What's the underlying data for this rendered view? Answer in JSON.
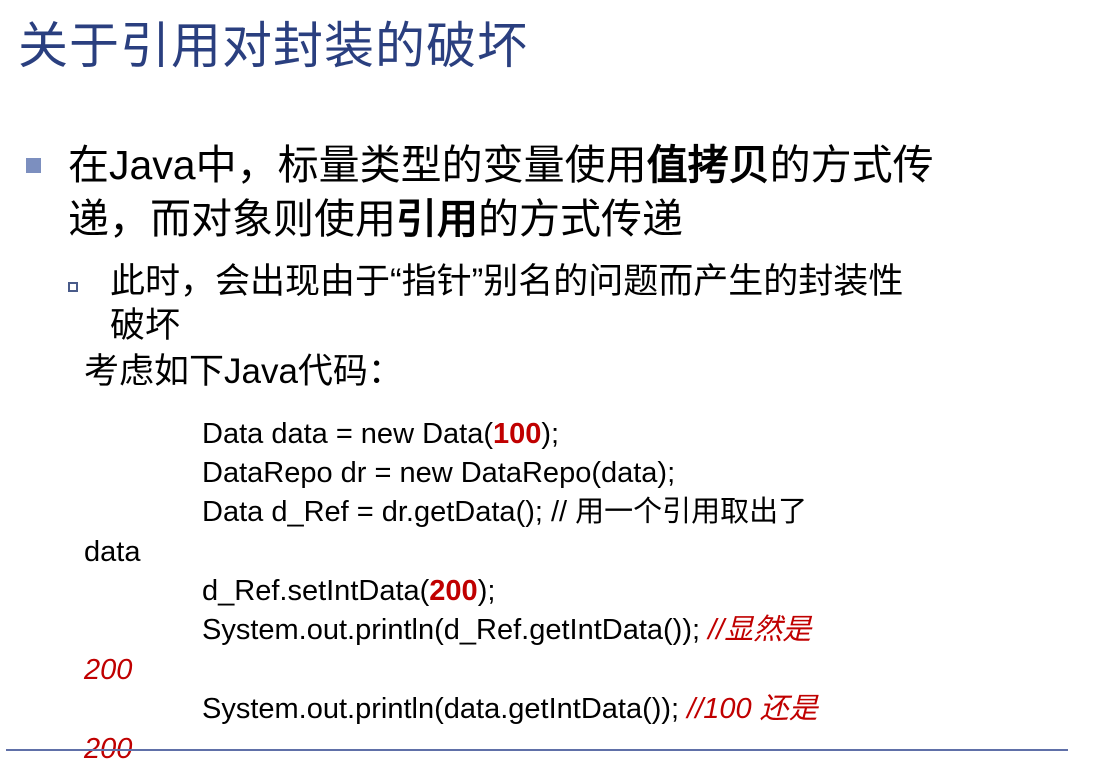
{
  "title": "关于引用对封装的破坏",
  "bullet1": {
    "line1_a": "在Java中，标量类型的变量使用",
    "line1_bold": "值拷贝",
    "line1_b": "的方式传",
    "line2_a": "递，而对象则使用",
    "line2_bold": "引用",
    "line2_b": "的方式传递"
  },
  "bullet2": {
    "line1": "此时，会出现由于“指针”别名的问题而产生的封装性",
    "line2": "破坏"
  },
  "consider": "考虑如下Java代码：",
  "code": {
    "l1_a": "Data data = new Data(",
    "l1_num": "100",
    "l1_b": ");",
    "l2": "DataRepo dr = new DataRepo(data);",
    "l3_code": "Data d_Ref = dr.getData();  ",
    "l3_comment": "// 用一个引用取出了",
    "l3_wrap": "data",
    "l4_a": "d_Ref.setIntData(",
    "l4_num": "200",
    "l4_b": ");",
    "l5_code": "System.out.println(d_Ref.getIntData());  ",
    "l5_comment": "//显然是",
    "l5_wrap": "200",
    "l6_code": "System.out.println(data.getIntData());  ",
    "l6_comment": "//100 还是",
    "l6_wrap": "200"
  },
  "colors": {
    "title": "#2a3f7f",
    "accent_red": "#c00000",
    "bullet": "#7c8fbf",
    "rule": "#6070a8"
  }
}
